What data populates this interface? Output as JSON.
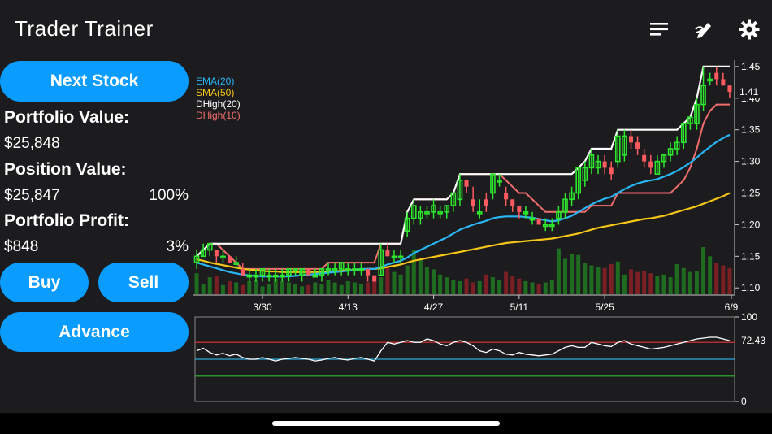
{
  "header": {
    "title": "Trader Trainer",
    "icons": [
      "list-icon",
      "edit-icon",
      "gear-icon"
    ]
  },
  "sidebar": {
    "next_stock_label": "Next Stock",
    "portfolio_value_label": "Portfolio Value:",
    "portfolio_value": "$25,848",
    "position_value_label": "Position Value:",
    "position_value": "$25,847",
    "position_pct": "100%",
    "portfolio_profit_label": "Portfolio Profit:",
    "portfolio_profit": "$848",
    "profit_pct": "3%",
    "buy_label": "Buy",
    "sell_label": "Sell",
    "advance_label": "Advance"
  },
  "colors": {
    "accent": "#0a9cff",
    "up": "#2ee82e",
    "down": "#ff5a5f",
    "ema": "#29b6f6",
    "sma": "#f5c518",
    "dhigh20": "#ffffff",
    "dhigh10": "#f26d6d"
  },
  "chart_data": [
    {
      "type": "line",
      "subtype": "candlestick+volume",
      "legend": [
        "EMA(20)",
        "SMA(50)",
        "DHigh(20)",
        "DHigh(10)"
      ],
      "legend_position": "top-left",
      "x_ticks": [
        "3/30",
        "4/13",
        "4/27",
        "5/11",
        "5/25",
        "6/9"
      ],
      "y_ticks": [
        "1.45",
        "1.40",
        "1.35",
        "1.30",
        "1.25",
        "1.20",
        "1.15",
        "1.10"
      ],
      "ylim": [
        1.09,
        1.455
      ],
      "last_price_label": "1.41",
      "candles": [
        [
          1.14,
          1.16,
          1.13,
          1.15
        ],
        [
          1.15,
          1.17,
          1.15,
          1.16
        ],
        [
          1.16,
          1.17,
          1.15,
          1.17
        ],
        [
          1.16,
          1.16,
          1.14,
          1.15
        ],
        [
          1.15,
          1.16,
          1.14,
          1.15
        ],
        [
          1.15,
          1.15,
          1.14,
          1.14
        ],
        [
          1.14,
          1.15,
          1.13,
          1.14
        ],
        [
          1.13,
          1.14,
          1.12,
          1.12
        ],
        [
          1.12,
          1.13,
          1.11,
          1.12
        ],
        [
          1.12,
          1.13,
          1.11,
          1.12
        ],
        [
          1.12,
          1.13,
          1.11,
          1.13
        ],
        [
          1.12,
          1.13,
          1.11,
          1.12
        ],
        [
          1.12,
          1.13,
          1.11,
          1.12
        ],
        [
          1.12,
          1.13,
          1.11,
          1.12
        ],
        [
          1.12,
          1.13,
          1.11,
          1.13
        ],
        [
          1.13,
          1.13,
          1.12,
          1.13
        ],
        [
          1.12,
          1.13,
          1.11,
          1.13
        ],
        [
          1.13,
          1.13,
          1.12,
          1.12
        ],
        [
          1.12,
          1.13,
          1.12,
          1.12
        ],
        [
          1.12,
          1.13,
          1.11,
          1.13
        ],
        [
          1.13,
          1.14,
          1.12,
          1.13
        ],
        [
          1.13,
          1.14,
          1.12,
          1.13
        ],
        [
          1.13,
          1.14,
          1.12,
          1.14
        ],
        [
          1.13,
          1.14,
          1.12,
          1.13
        ],
        [
          1.13,
          1.14,
          1.12,
          1.13
        ],
        [
          1.13,
          1.14,
          1.12,
          1.13
        ],
        [
          1.13,
          1.13,
          1.11,
          1.12
        ],
        [
          1.12,
          1.12,
          1.11,
          1.11
        ],
        [
          1.12,
          1.17,
          1.12,
          1.16
        ],
        [
          1.16,
          1.17,
          1.15,
          1.15
        ],
        [
          1.15,
          1.16,
          1.14,
          1.15
        ],
        [
          1.15,
          1.16,
          1.14,
          1.15
        ],
        [
          1.19,
          1.22,
          1.18,
          1.21
        ],
        [
          1.21,
          1.24,
          1.2,
          1.23
        ],
        [
          1.21,
          1.23,
          1.2,
          1.22
        ],
        [
          1.22,
          1.23,
          1.21,
          1.22
        ],
        [
          1.22,
          1.24,
          1.21,
          1.23
        ],
        [
          1.22,
          1.23,
          1.21,
          1.22
        ],
        [
          1.22,
          1.23,
          1.21,
          1.23
        ],
        [
          1.23,
          1.25,
          1.22,
          1.25
        ],
        [
          1.24,
          1.28,
          1.23,
          1.27
        ],
        [
          1.27,
          1.27,
          1.25,
          1.26
        ],
        [
          1.24,
          1.26,
          1.22,
          1.23
        ],
        [
          1.22,
          1.24,
          1.21,
          1.22
        ],
        [
          1.24,
          1.25,
          1.22,
          1.23
        ],
        [
          1.25,
          1.28,
          1.24,
          1.28
        ],
        [
          1.27,
          1.28,
          1.26,
          1.27
        ],
        [
          1.25,
          1.26,
          1.23,
          1.24
        ],
        [
          1.24,
          1.24,
          1.22,
          1.23
        ],
        [
          1.23,
          1.23,
          1.21,
          1.22
        ],
        [
          1.22,
          1.23,
          1.21,
          1.22
        ],
        [
          1.21,
          1.22,
          1.2,
          1.21
        ],
        [
          1.21,
          1.21,
          1.2,
          1.2
        ],
        [
          1.2,
          1.21,
          1.19,
          1.2
        ],
        [
          1.2,
          1.21,
          1.19,
          1.2
        ],
        [
          1.21,
          1.23,
          1.2,
          1.22
        ],
        [
          1.22,
          1.25,
          1.21,
          1.24
        ],
        [
          1.24,
          1.26,
          1.23,
          1.25
        ],
        [
          1.25,
          1.29,
          1.24,
          1.29
        ],
        [
          1.27,
          1.3,
          1.26,
          1.29
        ],
        [
          1.29,
          1.32,
          1.28,
          1.31
        ],
        [
          1.29,
          1.31,
          1.28,
          1.3
        ],
        [
          1.3,
          1.31,
          1.28,
          1.29
        ],
        [
          1.29,
          1.3,
          1.27,
          1.28
        ],
        [
          1.3,
          1.35,
          1.29,
          1.34
        ],
        [
          1.31,
          1.35,
          1.3,
          1.34
        ],
        [
          1.34,
          1.35,
          1.32,
          1.33
        ],
        [
          1.33,
          1.34,
          1.31,
          1.32
        ],
        [
          1.31,
          1.32,
          1.29,
          1.3
        ],
        [
          1.3,
          1.31,
          1.28,
          1.29
        ],
        [
          1.28,
          1.31,
          1.28,
          1.3
        ],
        [
          1.3,
          1.31,
          1.29,
          1.31
        ],
        [
          1.31,
          1.33,
          1.3,
          1.32
        ],
        [
          1.32,
          1.34,
          1.31,
          1.33
        ],
        [
          1.33,
          1.36,
          1.32,
          1.36
        ],
        [
          1.36,
          1.37,
          1.35,
          1.37
        ],
        [
          1.36,
          1.4,
          1.35,
          1.39
        ],
        [
          1.39,
          1.45,
          1.38,
          1.42
        ],
        [
          1.43,
          1.44,
          1.42,
          1.43
        ],
        [
          1.44,
          1.45,
          1.42,
          1.43
        ],
        [
          1.43,
          1.44,
          1.42,
          1.42
        ],
        [
          1.42,
          1.42,
          1.4,
          1.41
        ]
      ],
      "volume": [
        32,
        16,
        26,
        28,
        14,
        20,
        18,
        14,
        20,
        22,
        12,
        16,
        24,
        20,
        18,
        16,
        12,
        14,
        18,
        16,
        22,
        18,
        14,
        20,
        18,
        16,
        18,
        22,
        26,
        40,
        34,
        30,
        44,
        68,
        52,
        42,
        38,
        30,
        26,
        22,
        20,
        24,
        18,
        20,
        30,
        26,
        22,
        34,
        28,
        24,
        20,
        18,
        16,
        18,
        22,
        70,
        54,
        62,
        60,
        48,
        44,
        42,
        40,
        46,
        50,
        30,
        38,
        34,
        36,
        32,
        28,
        30,
        26,
        46,
        40,
        34,
        36,
        72,
        58,
        48,
        44,
        40
      ],
      "ema20": [
        1.14,
        1.137,
        1.134,
        1.131,
        1.128,
        1.125,
        1.123,
        1.121,
        1.12,
        1.119,
        1.118,
        1.118,
        1.118,
        1.118,
        1.118,
        1.119,
        1.12,
        1.121,
        1.122,
        1.123,
        1.124,
        1.125,
        1.126,
        1.127,
        1.128,
        1.13,
        1.13,
        1.13,
        1.133,
        1.137,
        1.14,
        1.143,
        1.148,
        1.155,
        1.16,
        1.165,
        1.17,
        1.175,
        1.18,
        1.186,
        1.192,
        1.196,
        1.2,
        1.203,
        1.206,
        1.21,
        1.212,
        1.213,
        1.213,
        1.213,
        1.212,
        1.211,
        1.209,
        1.207,
        1.205,
        1.207,
        1.21,
        1.214,
        1.22,
        1.226,
        1.232,
        1.237,
        1.241,
        1.244,
        1.25,
        1.256,
        1.261,
        1.265,
        1.268,
        1.27,
        1.272,
        1.276,
        1.28,
        1.285,
        1.291,
        1.298,
        1.306,
        1.315,
        1.323,
        1.331,
        1.337,
        1.342
      ],
      "sma50": [
        1.145,
        1.143,
        1.14,
        1.138,
        1.136,
        1.134,
        1.132,
        1.13,
        1.129,
        1.128,
        1.127,
        1.126,
        1.126,
        1.125,
        1.125,
        1.125,
        1.125,
        1.125,
        1.125,
        1.125,
        1.126,
        1.126,
        1.127,
        1.128,
        1.128,
        1.129,
        1.13,
        1.13,
        1.131,
        1.133,
        1.135,
        1.137,
        1.14,
        1.143,
        1.145,
        1.147,
        1.149,
        1.151,
        1.153,
        1.155,
        1.157,
        1.159,
        1.161,
        1.163,
        1.165,
        1.167,
        1.169,
        1.171,
        1.172,
        1.173,
        1.174,
        1.175,
        1.176,
        1.177,
        1.178,
        1.18,
        1.182,
        1.184,
        1.186,
        1.189,
        1.192,
        1.195,
        1.197,
        1.199,
        1.201,
        1.203,
        1.205,
        1.207,
        1.209,
        1.21,
        1.212,
        1.214,
        1.217,
        1.22,
        1.223,
        1.226,
        1.229,
        1.233,
        1.237,
        1.241,
        1.245,
        1.25
      ],
      "dhigh20": [
        1.15,
        1.16,
        1.17,
        1.17,
        1.17,
        1.17,
        1.17,
        1.17,
        1.17,
        1.17,
        1.17,
        1.17,
        1.17,
        1.17,
        1.17,
        1.17,
        1.17,
        1.17,
        1.17,
        1.17,
        1.17,
        1.17,
        1.17,
        1.17,
        1.17,
        1.17,
        1.17,
        1.17,
        1.17,
        1.17,
        1.17,
        1.17,
        1.22,
        1.24,
        1.24,
        1.24,
        1.24,
        1.24,
        1.24,
        1.25,
        1.28,
        1.28,
        1.28,
        1.28,
        1.28,
        1.28,
        1.28,
        1.28,
        1.28,
        1.28,
        1.28,
        1.28,
        1.28,
        1.28,
        1.28,
        1.28,
        1.28,
        1.28,
        1.29,
        1.3,
        1.32,
        1.32,
        1.32,
        1.32,
        1.35,
        1.35,
        1.35,
        1.35,
        1.35,
        1.35,
        1.35,
        1.35,
        1.35,
        1.35,
        1.36,
        1.37,
        1.4,
        1.45,
        1.45,
        1.45,
        1.45,
        1.45
      ],
      "dhigh10": [
        1.15,
        1.16,
        1.17,
        1.17,
        1.16,
        1.15,
        1.14,
        1.13,
        1.13,
        1.13,
        1.13,
        1.13,
        1.13,
        1.13,
        1.13,
        1.13,
        1.13,
        1.13,
        1.13,
        1.13,
        1.14,
        1.14,
        1.14,
        1.14,
        1.14,
        1.14,
        1.14,
        1.14,
        1.17,
        1.17,
        1.17,
        1.17,
        1.22,
        1.24,
        1.24,
        1.24,
        1.24,
        1.24,
        1.24,
        1.25,
        1.28,
        1.28,
        1.28,
        1.28,
        1.28,
        1.28,
        1.28,
        1.27,
        1.26,
        1.25,
        1.25,
        1.24,
        1.23,
        1.22,
        1.22,
        1.22,
        1.22,
        1.22,
        1.22,
        1.22,
        1.23,
        1.23,
        1.23,
        1.23,
        1.25,
        1.25,
        1.25,
        1.25,
        1.25,
        1.25,
        1.25,
        1.25,
        1.25,
        1.26,
        1.27,
        1.29,
        1.32,
        1.36,
        1.38,
        1.39,
        1.39,
        1.39
      ]
    },
    {
      "type": "line",
      "subtype": "oscillator",
      "ylim": [
        0,
        100
      ],
      "y_ticks": [
        "100",
        "0"
      ],
      "last_value_label": "72.43",
      "reference_lines": [
        70,
        50,
        30
      ],
      "values": [
        60,
        63,
        58,
        55,
        57,
        54,
        56,
        52,
        50,
        50,
        52,
        50,
        48,
        50,
        51,
        52,
        51,
        50,
        48,
        49,
        51,
        52,
        50,
        49,
        51,
        52,
        50,
        48,
        60,
        70,
        68,
        70,
        72,
        70,
        70,
        74,
        72,
        68,
        66,
        70,
        72,
        70,
        66,
        60,
        58,
        62,
        60,
        56,
        55,
        58,
        56,
        55,
        54,
        55,
        56,
        60,
        64,
        66,
        64,
        64,
        70,
        68,
        66,
        65,
        70,
        72,
        68,
        66,
        64,
        62,
        63,
        64,
        66,
        68,
        70,
        72,
        74,
        75,
        76,
        76,
        74,
        72
      ]
    }
  ]
}
